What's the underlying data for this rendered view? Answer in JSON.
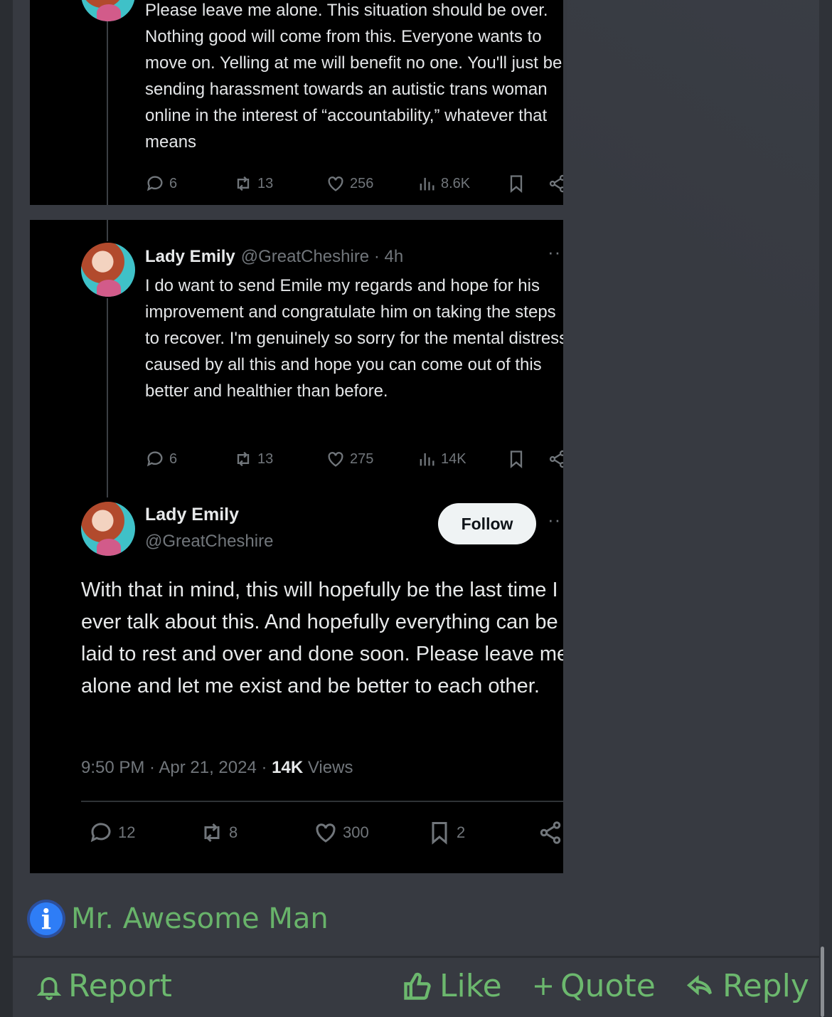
{
  "tweet1": {
    "text": "Please leave me alone. This situation should be over. Nothing good will come from this. Everyone wants to move on. Yelling at me will benefit no one. You'll just be sending harassment towards an autistic trans woman online in the interest of “accountability,” whatever that means",
    "replies": "6",
    "retweets": "13",
    "likes": "256",
    "views": "8.6K"
  },
  "tweet2": {
    "name": "Lady Emily",
    "handle": "@GreatCheshire · 4h",
    "more": "···",
    "text": "I do want to send Emile my regards and hope for his improvement and congratulate him on taking the steps to recover. I'm genuinely so sorry for the mental distress caused by all this and hope you can come out of this better and healthier than before.",
    "replies": "6",
    "retweets": "13",
    "likes": "275",
    "views": "14K"
  },
  "tweet3": {
    "name": "Lady Emily",
    "handle": "@GreatCheshire",
    "follow": "Follow",
    "more": "···",
    "text": "With that in mind, this will hopefully be the last time I ever talk about this. And hopefully everything can be laid to rest and over and done soon. Please leave me alone and let me exist and be better to each other.",
    "time": "9:50 PM · Apr 21, 2024 · ",
    "views_count": "14K",
    "views_label": " Views",
    "replies": "12",
    "retweets": "8",
    "likes": "300",
    "bookmarks": "2"
  },
  "post": {
    "author_badge": "i",
    "author": "Mr. Awesome Man"
  },
  "footer": {
    "report": "Report",
    "like": "Like",
    "quote": "Quote",
    "reply": "Reply"
  },
  "colors": {
    "accent_green": "#6cb86e",
    "post_bg": "#373a41",
    "tweet_bg": "#000000",
    "badge_blue": "#2e7df6"
  }
}
